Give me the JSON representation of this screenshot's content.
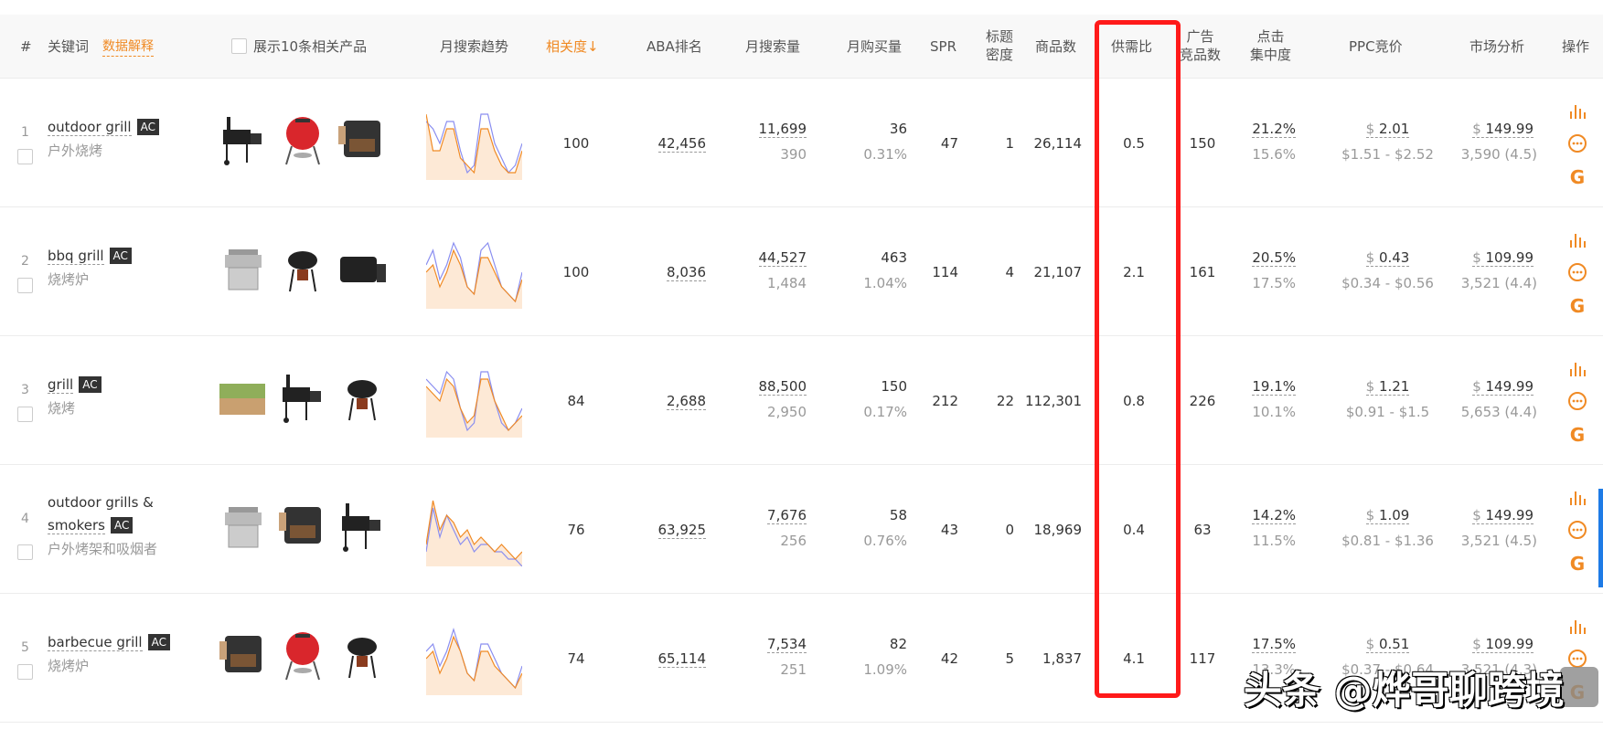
{
  "header": {
    "index": "#",
    "keyword": "关键词",
    "data_explain": "数据解释",
    "show_products": "展示10条相关产品",
    "trend": "月搜索趋势",
    "relevance": "相关度↓",
    "aba": "ABA排名",
    "monthly_search": "月搜索量",
    "monthly_purchase": "月购买量",
    "spr": "SPR",
    "title_density_1": "标题",
    "title_density_2": "密度",
    "product_count": "商品数",
    "supply_demand": "供需比",
    "ad_1": "广告",
    "ad_2": "竞品数",
    "click_1": "点击",
    "click_2": "集中度",
    "ppc": "PPC竞价",
    "market": "市场分析",
    "action": "操作"
  },
  "colors": {
    "accent": "#f08a24",
    "highlight_box": "#ff1a1a"
  },
  "rows": [
    {
      "index": "1",
      "keyword": "outdoor grill",
      "badge": "AC",
      "translation": "户外烧烤",
      "relevance": "100",
      "aba": "42,456",
      "search": "11,699",
      "search_sub": "390",
      "purchase": "36",
      "purchase_rate": "0.31%",
      "spr": "47",
      "title_density": "1",
      "products": "26,114",
      "supply_demand": "0.5",
      "ad_products": "150",
      "click": "21.2%",
      "click_sub": "15.6%",
      "ppc": "2.01",
      "ppc_range": "$1.51 - $2.52",
      "price": "149.99",
      "reviews": "3,590 (4.5)",
      "trend_a": [
        9,
        4,
        4,
        7,
        7,
        3,
        2,
        1,
        7,
        7,
        4,
        2,
        1,
        1,
        4
      ],
      "trend_b": [
        8,
        7,
        5,
        8,
        8,
        4,
        1,
        2,
        9,
        9,
        5,
        3,
        1,
        2,
        5
      ]
    },
    {
      "index": "2",
      "keyword": "bbq grill",
      "badge": "AC",
      "translation": "烧烤炉",
      "relevance": "100",
      "aba": "8,036",
      "search": "44,527",
      "search_sub": "1,484",
      "purchase": "463",
      "purchase_rate": "1.04%",
      "spr": "114",
      "title_density": "4",
      "products": "21,107",
      "supply_demand": "2.1",
      "ad_products": "161",
      "click": "20.5%",
      "click_sub": "17.5%",
      "ppc": "0.43",
      "ppc_range": "$0.34 - $0.56",
      "price": "109.99",
      "reviews": "3,521 (4.4)",
      "trend_a": [
        5,
        6,
        3,
        5,
        8,
        6,
        3,
        2,
        7,
        7,
        5,
        3,
        2,
        1,
        4
      ],
      "trend_b": [
        6,
        8,
        4,
        6,
        9,
        7,
        3,
        2,
        8,
        9,
        6,
        3,
        2,
        1,
        5
      ]
    },
    {
      "index": "3",
      "keyword": "grill",
      "badge": "AC",
      "translation": "烧烤",
      "relevance": "84",
      "aba": "2,688",
      "search": "88,500",
      "search_sub": "2,950",
      "purchase": "150",
      "purchase_rate": "0.17%",
      "spr": "212",
      "title_density": "22",
      "products": "112,301",
      "supply_demand": "0.8",
      "ad_products": "226",
      "click": "19.1%",
      "click_sub": "10.1%",
      "ppc": "1.21",
      "ppc_range": "$0.91 - $1.5",
      "price": "149.99",
      "reviews": "5,653 (4.4)",
      "trend_a": [
        7,
        6,
        5,
        8,
        7,
        4,
        2,
        3,
        8,
        8,
        5,
        3,
        1,
        2,
        3
      ],
      "trend_b": [
        8,
        7,
        6,
        9,
        8,
        4,
        1,
        2,
        9,
        9,
        5,
        2,
        1,
        2,
        4
      ]
    },
    {
      "index": "4",
      "keyword_line1": "outdoor grills &",
      "keyword_line2": "smokers",
      "badge": "AC",
      "translation": "户外烤架和吸烟者",
      "relevance": "76",
      "aba": "63,925",
      "search": "7,676",
      "search_sub": "256",
      "purchase": "58",
      "purchase_rate": "0.76%",
      "spr": "43",
      "title_density": "0",
      "products": "18,969",
      "supply_demand": "0.4",
      "ad_products": "63",
      "click": "14.2%",
      "click_sub": "11.5%",
      "ppc": "1.09",
      "ppc_range": "$0.81 - $1.36",
      "price": "149.99",
      "reviews": "3,521 (4.5)",
      "trend_a": [
        3,
        9,
        5,
        7,
        6,
        4,
        5,
        3,
        4,
        3,
        2,
        3,
        2,
        1,
        2
      ],
      "trend_b": [
        2,
        8,
        4,
        7,
        5,
        3,
        4,
        2,
        3,
        3,
        2,
        2,
        1,
        1,
        0
      ]
    },
    {
      "index": "5",
      "keyword": "barbecue grill",
      "badge": "AC",
      "translation": "烧烤炉",
      "relevance": "74",
      "aba": "65,114",
      "search": "7,534",
      "search_sub": "251",
      "purchase": "82",
      "purchase_rate": "1.09%",
      "spr": "42",
      "title_density": "5",
      "products": "1,837",
      "supply_demand": "4.1",
      "ad_products": "117",
      "click": "17.5%",
      "click_sub": "13.3%",
      "ppc": "0.51",
      "ppc_range": "$0.37 - $0.64",
      "price": "109.99",
      "reviews": "3,521 (4.3)",
      "trend_a": [
        5,
        6,
        3,
        5,
        8,
        6,
        3,
        2,
        6,
        6,
        4,
        3,
        2,
        1,
        3
      ],
      "trend_b": [
        6,
        7,
        4,
        6,
        9,
        6,
        3,
        2,
        7,
        7,
        5,
        3,
        2,
        1,
        4
      ]
    }
  ],
  "watermark": "头条 @烨哥聊跨境"
}
